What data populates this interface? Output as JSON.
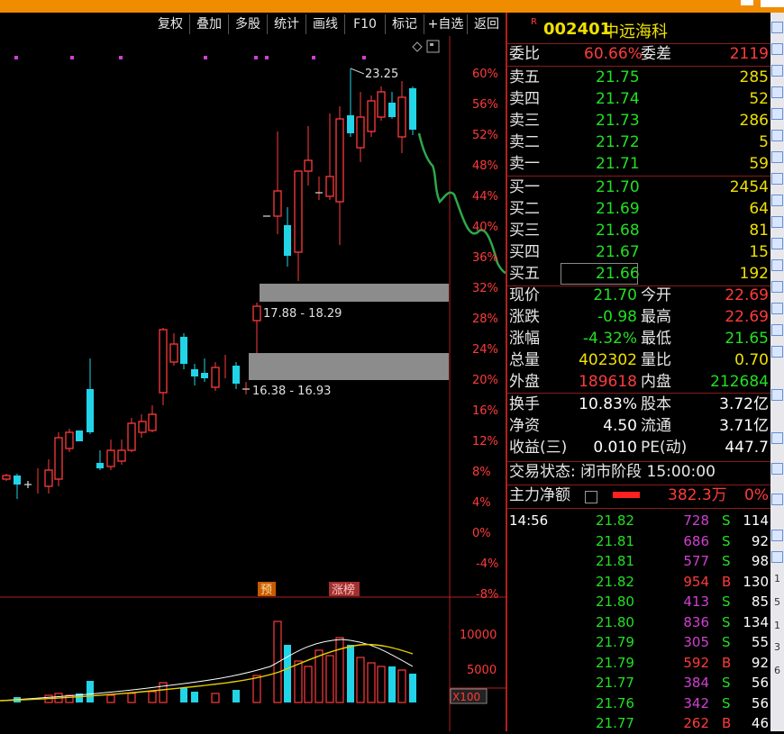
{
  "toolbar": {
    "buttons": [
      "复权",
      "叠加",
      "多股",
      "统计",
      "画线",
      "F10",
      "标记",
      "+自选",
      "返回"
    ]
  },
  "chart": {
    "right_axis_pct": [
      "60%",
      "56%",
      "52%",
      "48%",
      "44%",
      "40%",
      "36%",
      "32%",
      "28%",
      "24%",
      "20%",
      "16%",
      "12%",
      "8%",
      "4%",
      "0%",
      "-4%",
      "-8%"
    ],
    "high_label": "23.25",
    "zone_upper_label": "17.88 - 18.29",
    "zone_lower_label": "16.38 - 16.93",
    "marker_pre": "预",
    "marker_rank": "涨榜",
    "volume_axis": [
      "10000",
      "5000"
    ],
    "volume_unit": "X100",
    "colors": {
      "up": "#ff3b3b",
      "down": "#22d4e8",
      "axis_red": "#ff3b3b",
      "zone": "#8c8c8c"
    }
  },
  "stock": {
    "badge": "R",
    "code": "002401",
    "name": "中远海科"
  },
  "weibi": {
    "label": "委比",
    "value": "60.66%",
    "label2": "委差",
    "value2": "2119"
  },
  "asks": [
    {
      "label": "卖五",
      "price": "21.75",
      "vol": "285"
    },
    {
      "label": "卖四",
      "price": "21.74",
      "vol": "52"
    },
    {
      "label": "卖三",
      "price": "21.73",
      "vol": "286"
    },
    {
      "label": "卖二",
      "price": "21.72",
      "vol": "5"
    },
    {
      "label": "卖一",
      "price": "21.71",
      "vol": "59"
    }
  ],
  "bids": [
    {
      "label": "买一",
      "price": "21.70",
      "vol": "2454"
    },
    {
      "label": "买二",
      "price": "21.69",
      "vol": "64"
    },
    {
      "label": "买三",
      "price": "21.68",
      "vol": "81"
    },
    {
      "label": "买四",
      "price": "21.67",
      "vol": "15"
    },
    {
      "label": "买五",
      "price": "21.66",
      "vol": "192"
    }
  ],
  "quote": [
    {
      "l1": "现价",
      "v1": "21.70",
      "l2": "今开",
      "v2": "22.69"
    },
    {
      "l1": "涨跌",
      "v1": "-0.98",
      "l2": "最高",
      "v2": "22.69"
    },
    {
      "l1": "涨幅",
      "v1": "-4.32%",
      "l2": "最低",
      "v2": "21.65"
    },
    {
      "l1": "总量",
      "v1": "402302",
      "l2": "量比",
      "v2": "0.70"
    },
    {
      "l1": "外盘",
      "v1": "189618",
      "l2": "内盘",
      "v2": "212684"
    }
  ],
  "fundamentals": [
    {
      "l1": "换手",
      "v1": "10.83%",
      "l2": "股本",
      "v2": "3.72亿"
    },
    {
      "l1": "净资",
      "v1": "4.50",
      "l2": "流通",
      "v2": "3.71亿"
    },
    {
      "l1": "收益(三)",
      "v1": "0.010",
      "l2": "PE(动)",
      "v2": "447.7"
    }
  ],
  "trade_status": "交易状态: 闭市阶段 15:00:00",
  "main_net": {
    "label": "主力净额",
    "value": "382.3万",
    "pct": "0%"
  },
  "ticks_time": "14:56",
  "ticks": [
    {
      "price": "21.82",
      "vol": "728",
      "side": "S",
      "n": "114"
    },
    {
      "price": "21.81",
      "vol": "686",
      "side": "S",
      "n": "92"
    },
    {
      "price": "21.81",
      "vol": "577",
      "side": "S",
      "n": "98"
    },
    {
      "price": "21.82",
      "vol": "954",
      "side": "B",
      "n": "130"
    },
    {
      "price": "21.80",
      "vol": "413",
      "side": "S",
      "n": "85"
    },
    {
      "price": "21.80",
      "vol": "836",
      "side": "S",
      "n": "134"
    },
    {
      "price": "21.79",
      "vol": "305",
      "side": "S",
      "n": "55"
    },
    {
      "price": "21.79",
      "vol": "592",
      "side": "B",
      "n": "92"
    },
    {
      "price": "21.77",
      "vol": "384",
      "side": "S",
      "n": "56"
    },
    {
      "price": "21.76",
      "vol": "342",
      "side": "S",
      "n": "56"
    },
    {
      "price": "21.77",
      "vol": "262",
      "side": "B",
      "n": "46"
    }
  ],
  "sidebar_numbers": [
    "1",
    "5",
    "1",
    "3",
    "6"
  ]
}
